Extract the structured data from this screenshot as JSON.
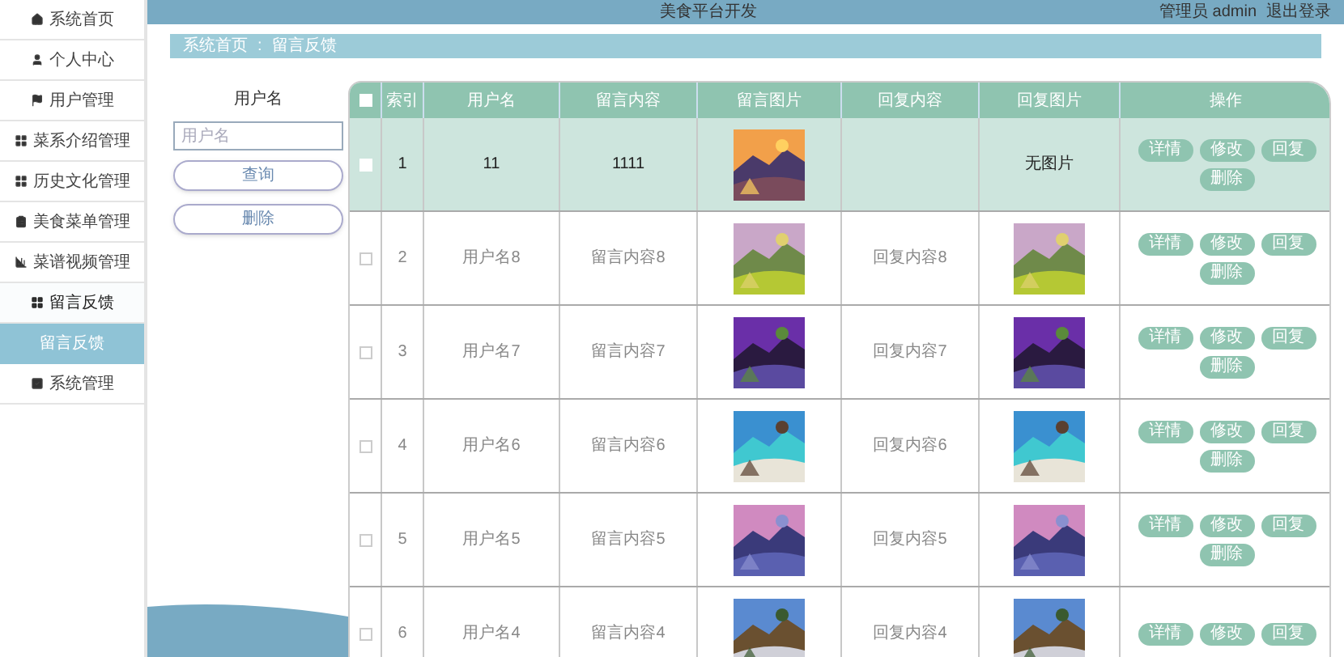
{
  "sidebar": {
    "items": [
      {
        "label": "系统首页"
      },
      {
        "label": "个人中心"
      },
      {
        "label": "用户管理"
      },
      {
        "label": "菜系介绍管理"
      },
      {
        "label": "历史文化管理"
      },
      {
        "label": "美食菜单管理"
      },
      {
        "label": "菜谱视频管理"
      },
      {
        "label": "留言反馈",
        "expanded": true,
        "children": [
          {
            "label": "留言反馈",
            "selected": true
          }
        ]
      },
      {
        "label": "系统管理"
      }
    ]
  },
  "header": {
    "title": "美食平台开发",
    "user": "管理员 admin",
    "logout": "退出登录"
  },
  "breadcrumb": [
    "系统首页",
    ":",
    "留言反馈"
  ],
  "search": {
    "label": "用户名",
    "placeholder": "用户名",
    "buttons": [
      "查询",
      "删除"
    ]
  },
  "table": {
    "select_all": {
      "checked": false
    },
    "columns": [
      "索引",
      "用户名",
      "留言内容",
      "留言图片",
      "回复内容",
      "回复图片",
      "操作"
    ],
    "rows": [
      {
        "selected": true,
        "index": "1",
        "user": "11",
        "message": "1111",
        "image": {
          "kind": "picture"
        },
        "reply_image": {
          "kind": "text",
          "text": "无图片"
        },
        "actions": [
          "详情",
          "修改",
          "回复",
          "删除"
        ]
      },
      {
        "selected": false,
        "index": "2",
        "user": "用户名8",
        "message": "留言内容8",
        "image": {
          "kind": "picture"
        },
        "reply": "回复内容8",
        "reply_image": {
          "kind": "picture"
        },
        "actions": [
          "详情",
          "修改",
          "回复",
          "删除"
        ]
      },
      {
        "selected": false,
        "index": "3",
        "user": "用户名7",
        "message": "留言内容7",
        "image": {
          "kind": "picture"
        },
        "reply": "回复内容7",
        "reply_image": {
          "kind": "picture"
        },
        "actions": [
          "详情",
          "修改",
          "回复",
          "删除"
        ]
      },
      {
        "selected": false,
        "index": "4",
        "user": "用户名6",
        "message": "留言内容6",
        "image": {
          "kind": "picture"
        },
        "reply": "回复内容6",
        "reply_image": {
          "kind": "picture"
        },
        "actions": [
          "详情",
          "修改",
          "回复",
          "删除"
        ]
      },
      {
        "selected": false,
        "index": "5",
        "user": "用户名5",
        "message": "留言内容5",
        "image": {
          "kind": "picture"
        },
        "reply": "回复内容5",
        "reply_image": {
          "kind": "picture"
        },
        "actions": [
          "详情",
          "修改",
          "回复",
          "删除"
        ]
      },
      {
        "selected": false,
        "index": "6",
        "user": "用户名4",
        "message": "留言内容4",
        "image": {
          "kind": "picture"
        },
        "reply": "回复内容4",
        "reply_image": {
          "kind": "picture"
        },
        "actions": [
          "详情",
          "修改",
          "回复"
        ]
      }
    ]
  }
}
